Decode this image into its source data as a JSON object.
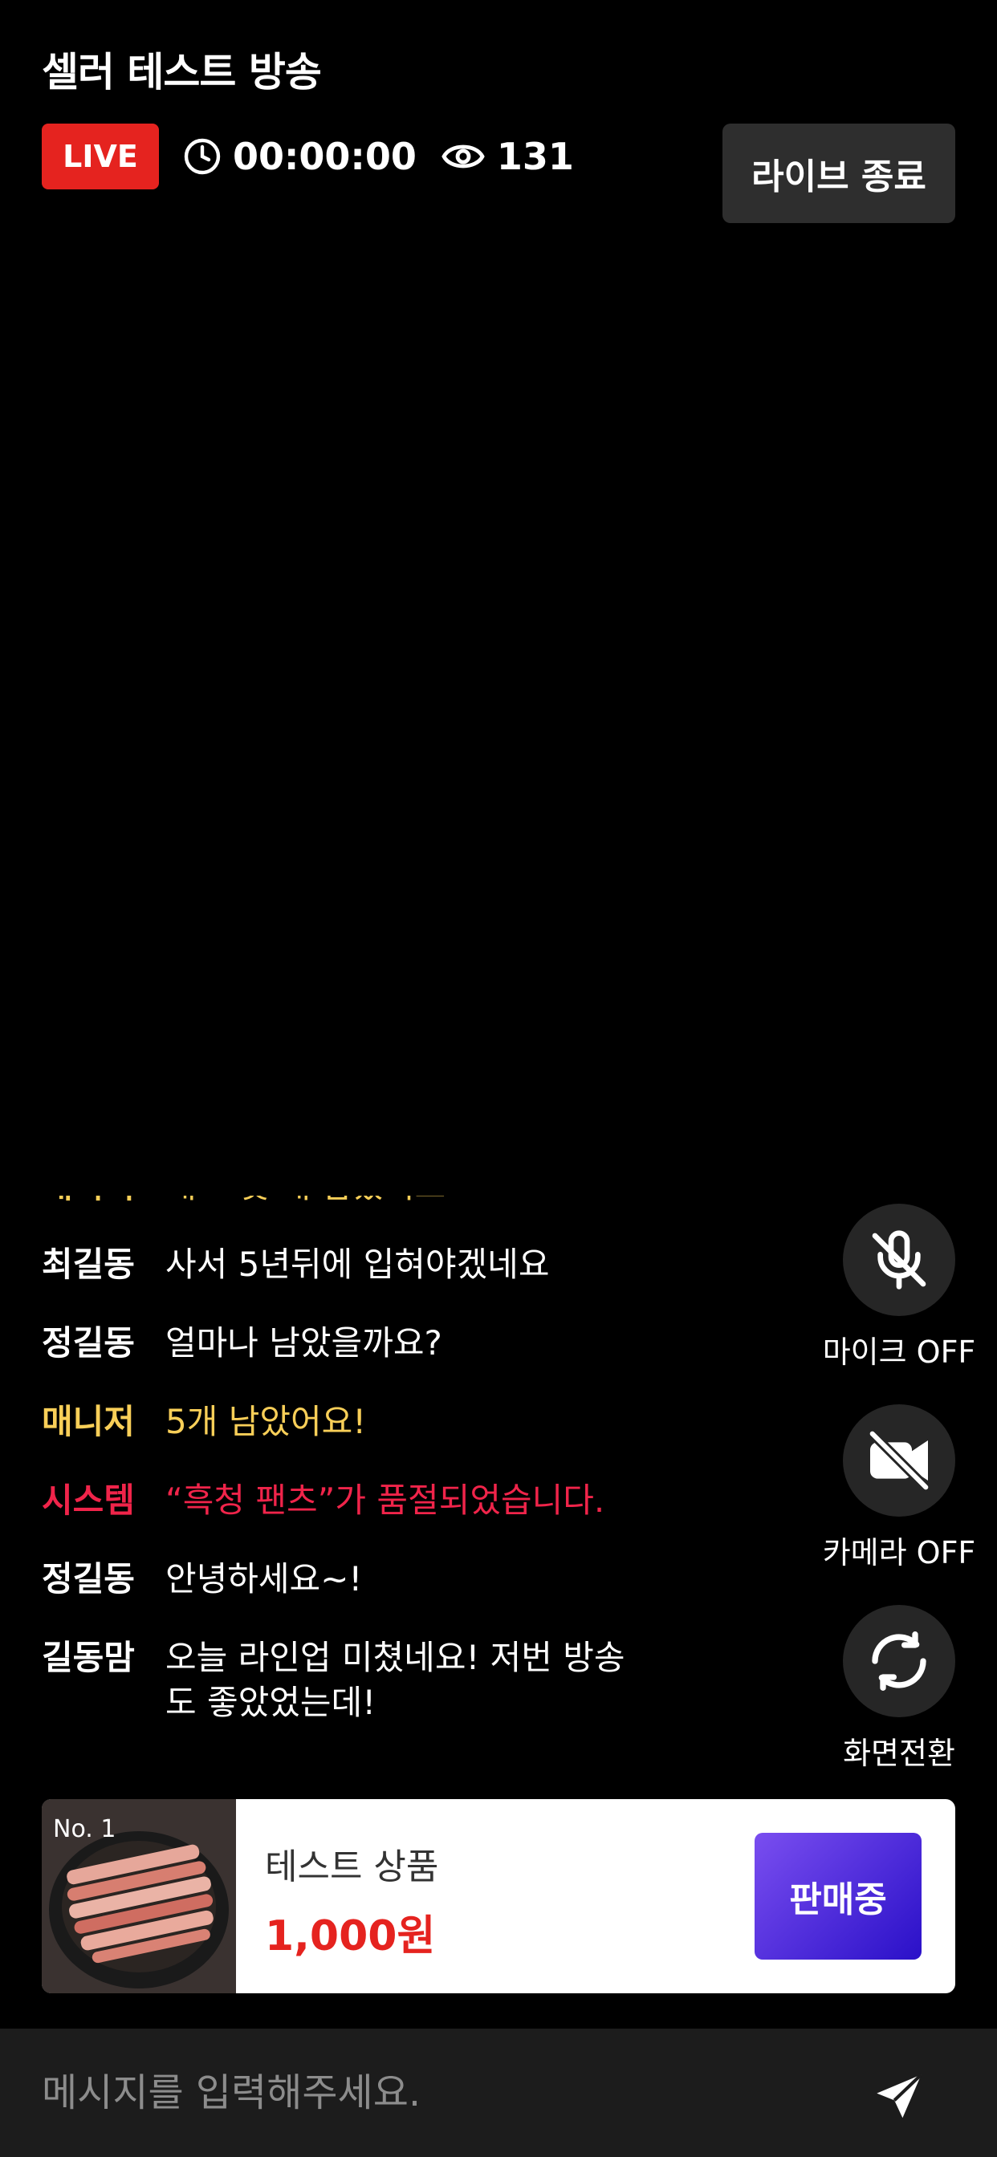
{
  "header": {
    "title": "셀러 테스트 방송",
    "live_badge": "LIVE",
    "elapsed_time": "00:00:00",
    "viewer_count": "131",
    "end_button": "라이브 종료"
  },
  "chat": {
    "messages": [
      {
        "name": "매니저",
        "text": "재고 몇 개 남았어요",
        "type": "manager"
      },
      {
        "name": "최길동",
        "text": "사서 5년뒤에 입혀야겠네요",
        "type": "normal"
      },
      {
        "name": "정길동",
        "text": "얼마나 남았을까요?",
        "type": "normal"
      },
      {
        "name": "매니저",
        "text": "5개 남았어요!",
        "type": "manager"
      },
      {
        "name": "시스템",
        "text": "“흑청 팬츠”가 품절되었습니다.",
        "type": "system"
      },
      {
        "name": "정길동",
        "text": "안녕하세요~!",
        "type": "normal"
      },
      {
        "name": "길동맘",
        "text": "오늘 라인업 미쳤네요! 저번 방송도 좋았었는데!",
        "type": "normal"
      }
    ]
  },
  "controls": {
    "mic_label": "마이크 OFF",
    "camera_label": "카메라 OFF",
    "switch_label": "화면전환",
    "mic_icon": "mic-off-icon",
    "camera_icon": "camera-off-icon",
    "switch_icon": "refresh-icon"
  },
  "product": {
    "number": "No. 1",
    "name": "테스트 상품",
    "price": "1,000원",
    "status_button": "판매중"
  },
  "input": {
    "placeholder": "메시지를 입력해주세요.",
    "send_icon": "send-icon"
  },
  "colors": {
    "live_red": "#e5231f",
    "manager_yellow": "#f9cf58",
    "system_red": "#f0244a",
    "button_purple": "#5a2ee0"
  }
}
